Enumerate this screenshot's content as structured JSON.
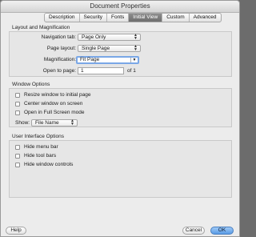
{
  "window": {
    "title": "Document Properties"
  },
  "tabs": [
    {
      "label": "Description",
      "active": false
    },
    {
      "label": "Security",
      "active": false
    },
    {
      "label": "Fonts",
      "active": false
    },
    {
      "label": "Initial View",
      "active": true
    },
    {
      "label": "Custom",
      "active": false
    },
    {
      "label": "Advanced",
      "active": false
    }
  ],
  "layout_section": {
    "title": "Layout and Magnification",
    "navigation_tab": {
      "label": "Navigation tab:",
      "value": "Page Only"
    },
    "page_layout": {
      "label": "Page layout:",
      "value": "Single Page"
    },
    "magnification": {
      "label": "Magnification:",
      "value": "Fit Page"
    },
    "open_to_page": {
      "label": "Open to page:",
      "value": "1",
      "suffix": "of 1"
    }
  },
  "window_section": {
    "title": "Window Options",
    "resize": "Resize window to initial page",
    "center": "Center window on screen",
    "fullscreen": "Open in Full Screen mode",
    "show": {
      "label": "Show:",
      "value": "File Name"
    }
  },
  "ui_section": {
    "title": "User Interface Options",
    "hide_menu": "Hide menu bar",
    "hide_tool": "Hide tool bars",
    "hide_window": "Hide window controls"
  },
  "buttons": {
    "help": "Help",
    "cancel": "Cancel",
    "ok": "OK"
  },
  "colors": {
    "accent": "#5a9be5",
    "active_tab": "#7a7a7a"
  }
}
